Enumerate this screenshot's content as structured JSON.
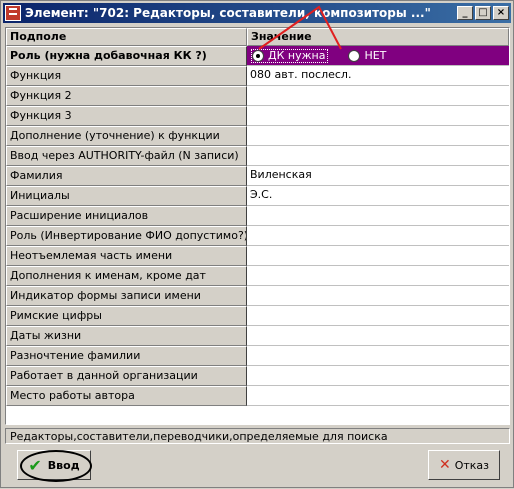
{
  "window": {
    "title": "Элемент: \"702: Редакторы, составители, композиторы ...\"",
    "minimize_glyph": "_",
    "maximize_glyph": "□",
    "close_glyph": "×"
  },
  "grid": {
    "columns": [
      "Подполе",
      "Значение"
    ],
    "rows": [
      {
        "name": "Роль (нужна добавочная КК ?)",
        "value": ""
      },
      {
        "name": "Функция",
        "value": "080 авт. послесл."
      },
      {
        "name": "Функция 2",
        "value": ""
      },
      {
        "name": "Функция 3",
        "value": ""
      },
      {
        "name": "Дополнение (уточнение) к функции",
        "value": ""
      },
      {
        "name": "Ввод через AUTHORITY-файл (N записи)",
        "value": ""
      },
      {
        "name": "Фамилия",
        "value": "Виленская"
      },
      {
        "name": "Инициалы",
        "value": "Э.С."
      },
      {
        "name": "Расширение инициалов",
        "value": ""
      },
      {
        "name": "Роль (Инвертирование ФИО допустимо?)",
        "value": ""
      },
      {
        "name": "Неотъемлемая часть имени",
        "value": ""
      },
      {
        "name": "Дополнения к именам, кроме дат",
        "value": ""
      },
      {
        "name": "Индикатор формы записи имени",
        "value": ""
      },
      {
        "name": "Римские цифры",
        "value": ""
      },
      {
        "name": "Даты жизни",
        "value": ""
      },
      {
        "name": "Разночтение фамилии",
        "value": ""
      },
      {
        "name": "Работает в данной организации",
        "value": ""
      },
      {
        "name": "Место работы автора",
        "value": ""
      }
    ],
    "role_options": [
      {
        "label": "ДК нужна",
        "checked": true
      },
      {
        "label": "НЕТ",
        "checked": false
      }
    ]
  },
  "status_text": "Редакторы,составители,переводчики,определяемые для поиска",
  "buttons": {
    "ok_label": "Ввод",
    "cancel_label": "Отказ"
  },
  "colors": {
    "selected_row": "#800080",
    "annotation_arrow": "#e02020",
    "title_bar": "#0a246a"
  },
  "icons": {
    "ok": "check-icon",
    "cancel": "x-icon"
  }
}
